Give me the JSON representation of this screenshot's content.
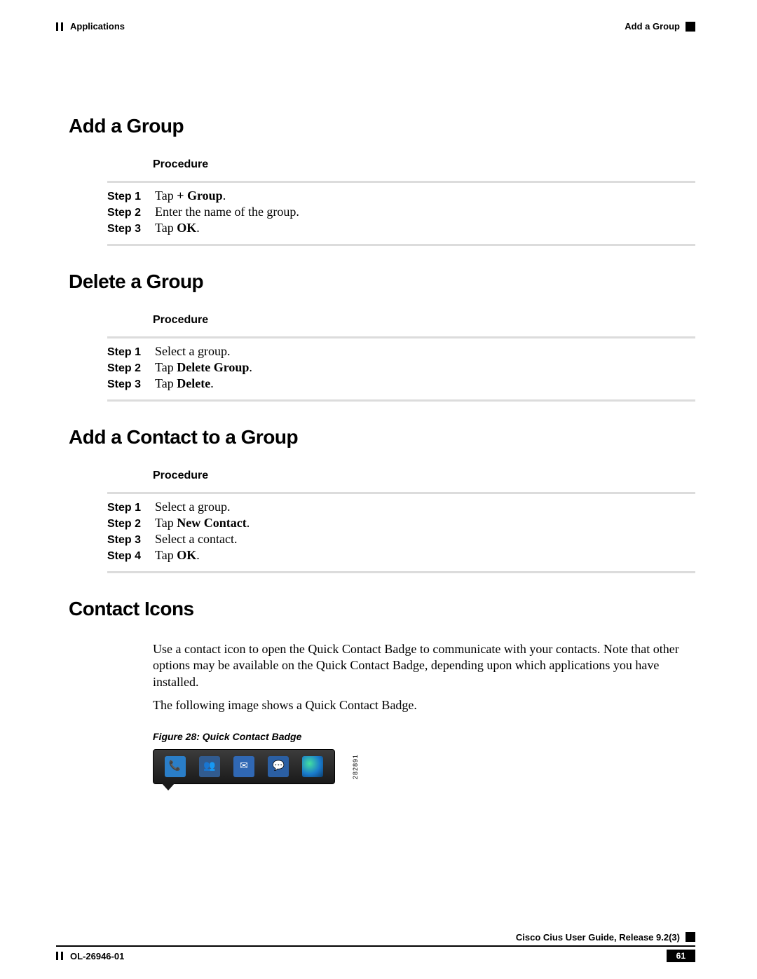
{
  "header": {
    "chapter": "Applications",
    "section": "Add a Group"
  },
  "sections": {
    "add_group": {
      "title": "Add a Group",
      "procedure_label": "Procedure",
      "steps": [
        {
          "label": "Step 1",
          "text": "Tap ",
          "bold": "+ Group",
          "suffix": "."
        },
        {
          "label": "Step 2",
          "text": "Enter the name of the group.",
          "bold": "",
          "suffix": ""
        },
        {
          "label": "Step 3",
          "text": "Tap ",
          "bold": "OK",
          "suffix": "."
        }
      ]
    },
    "delete_group": {
      "title": "Delete a Group",
      "procedure_label": "Procedure",
      "steps": [
        {
          "label": "Step 1",
          "text": "Select a group.",
          "bold": "",
          "suffix": ""
        },
        {
          "label": "Step 2",
          "text": "Tap ",
          "bold": "Delete Group",
          "suffix": "."
        },
        {
          "label": "Step 3",
          "text": "Tap ",
          "bold": "Delete",
          "suffix": "."
        }
      ]
    },
    "add_contact": {
      "title": "Add a Contact to a Group",
      "procedure_label": "Procedure",
      "steps": [
        {
          "label": "Step 1",
          "text": "Select a group.",
          "bold": "",
          "suffix": ""
        },
        {
          "label": "Step 2",
          "text": "Tap ",
          "bold": "New Contact",
          "suffix": "."
        },
        {
          "label": "Step 3",
          "text": "Select a contact.",
          "bold": "",
          "suffix": ""
        },
        {
          "label": "Step 4",
          "text": "Tap ",
          "bold": "OK",
          "suffix": "."
        }
      ]
    },
    "contact_icons": {
      "title": "Contact Icons",
      "para1": "Use a contact icon to open the Quick Contact Badge to communicate with your contacts. Note that other options may be available on the Quick Contact Badge, depending upon which applications you have installed.",
      "para2": "The following image shows a Quick Contact Badge.",
      "figure_caption": "Figure 28: Quick Contact Badge",
      "figure_sidelabel": "282891"
    }
  },
  "icons": {
    "phone": "📞",
    "contacts": "👥",
    "mail": "✉",
    "chat": "💬",
    "globe": ""
  },
  "footer": {
    "product": "Cisco Cius User Guide, Release 9.2(3)",
    "docnum": "OL-26946-01",
    "page": "61"
  }
}
